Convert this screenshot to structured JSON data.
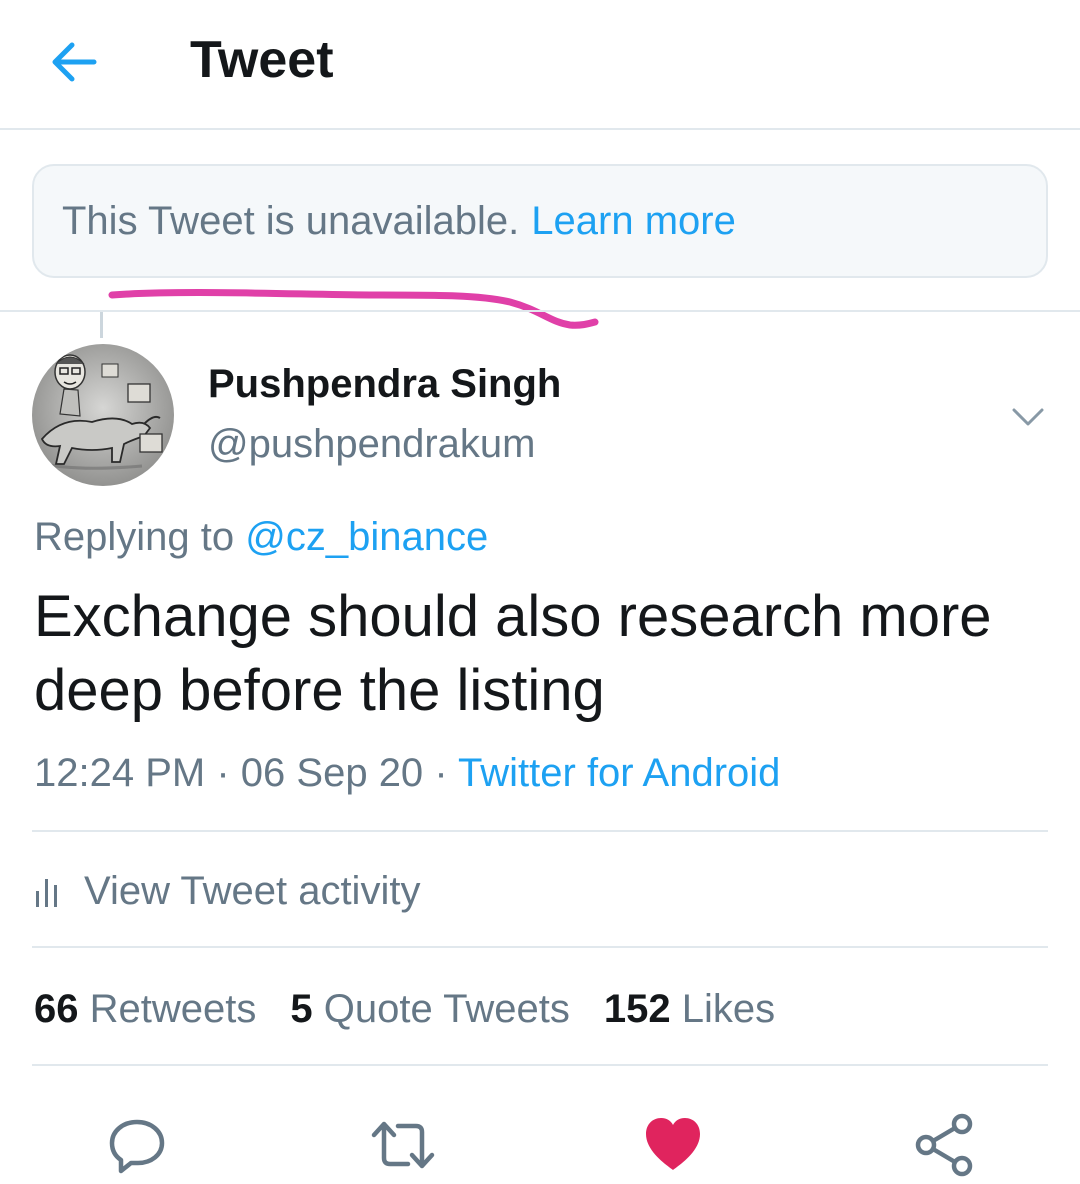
{
  "header": {
    "title": "Tweet",
    "back_icon": "arrow-left-icon"
  },
  "unavailable_notice": {
    "text": "This Tweet is unavailable.",
    "link": "Learn more"
  },
  "tweet": {
    "author": {
      "display_name": "Pushpendra Singh",
      "handle": "@pushpendrakum",
      "avatar_icon": "avatar-sketch-image"
    },
    "replying_to_label": "Replying to",
    "replying_to_handle": "@cz_binance",
    "text": "Exchange should also research more deep before the listing",
    "time": "12:24 PM",
    "separator": "·",
    "date": "06 Sep 20",
    "source": "Twitter for Android"
  },
  "activity": {
    "label": "View Tweet activity",
    "icon": "bar-chart-icon"
  },
  "stats": {
    "retweets_count": "66",
    "retweets_label": "Retweets",
    "quotes_count": "5",
    "quotes_label": "Quote Tweets",
    "likes_count": "152",
    "likes_label": "Likes"
  },
  "actions": {
    "reply_icon": "reply-icon",
    "retweet_icon": "retweet-icon",
    "like_icon": "heart-icon",
    "share_icon": "share-icon",
    "like_state": "liked"
  },
  "colors": {
    "accent": "#1da1f2",
    "like": "#e0245e",
    "annotation": "#e040a8",
    "muted_text": "#657786",
    "divider": "#e1e8ed"
  }
}
